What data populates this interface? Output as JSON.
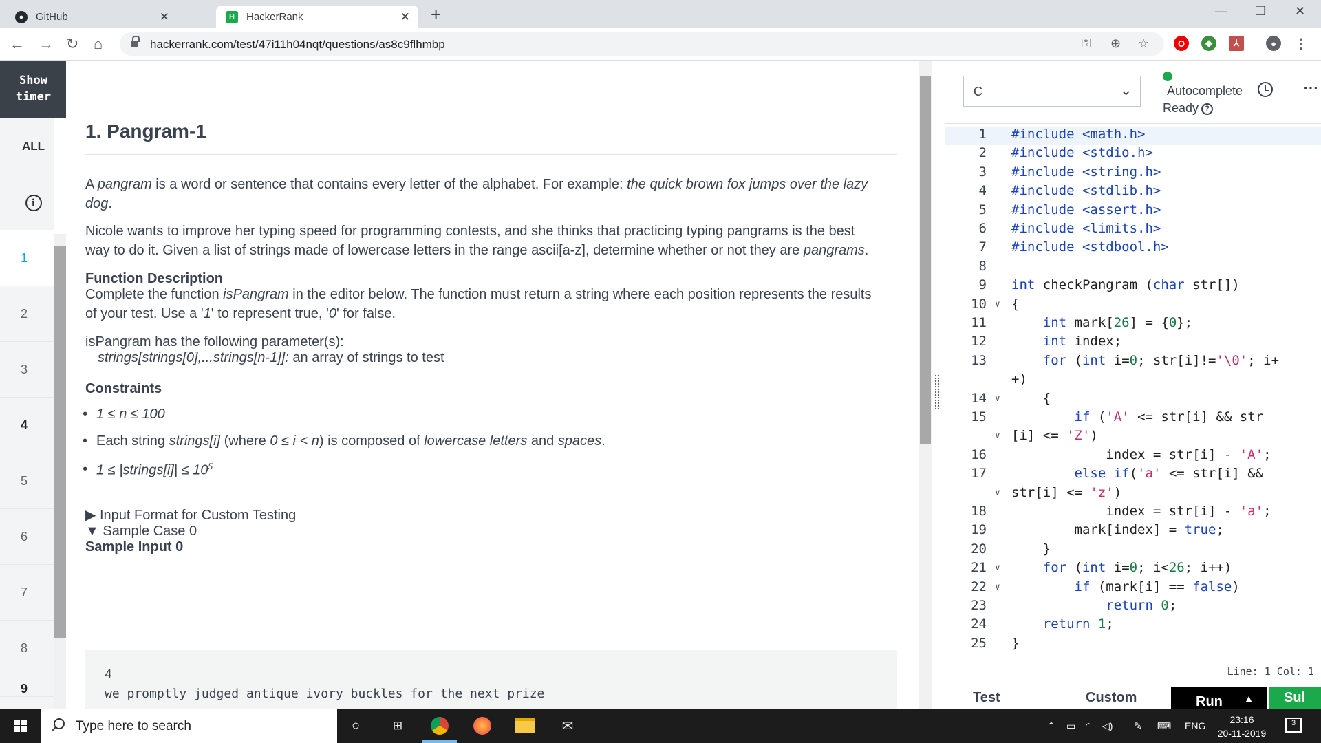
{
  "browser": {
    "tabs": [
      {
        "title": "GitHub",
        "icon": "github-icon"
      },
      {
        "title": "HackerRank",
        "icon": "hackerrank-icon"
      }
    ],
    "url": "hackerrank.com/test/47i11h04nqt/questions/as8c9flhmbp"
  },
  "sidebar": {
    "timer_line1": "Show",
    "timer_line2": "timer",
    "all_label": "ALL",
    "questions": [
      "1",
      "2",
      "3",
      "4",
      "5",
      "6",
      "7",
      "8",
      "9"
    ]
  },
  "problem": {
    "title": "1. Pangram-1",
    "intro_a": "A ",
    "intro_term": "pangram",
    "intro_b": " is a word or sentence that contains every letter of the alphabet.  For example: ",
    "intro_example_1": "the quick brown fox jumps over the lazy",
    "intro_example_2": "dog",
    "intro_end": ".",
    "para2_line1": "Nicole wants to improve her typing speed for programming contests, and she thinks that practicing typing pangrams is the best",
    "para2_line2a": "way to do it.  Given a list of strings made of lowercase letters in the range ascii[a-z], determine whether or not they are ",
    "para2_term": "pangrams",
    "para2_end": ".",
    "fd_heading": "Function Description",
    "fd_line1a": "Complete the function ",
    "fd_func": "isPangram",
    "fd_line1b": " in the editor below. The function must return a string where each position represents the results",
    "fd_line2a": "of your test. Use a '",
    "fd_one": "1",
    "fd_line2b": "' to represent true, '",
    "fd_zero": "0",
    "fd_line2c": "' for false.",
    "params_intro": "isPangram has the following parameter(s):",
    "param_sig": "strings[strings[0],...strings[n-1]]:",
    "param_desc": "  an array of strings to test",
    "constraints_heading": "Constraints",
    "constraint_1": "1 ≤ n ≤ 100",
    "constraint_2a": "Each string ",
    "constraint_2b": "strings[i]",
    "constraint_2c": " (where ",
    "constraint_2d": "0 ≤ i < n",
    "constraint_2e": ") is composed of ",
    "constraint_2f": "lowercase letters",
    "constraint_2g": " and ",
    "constraint_2h": "spaces",
    "constraint_2i": ".",
    "constraint_3": "1 ≤ |strings[i]| ≤ 10",
    "constraint_3_sup": "5",
    "input_format_label": "▶ Input Format for Custom Testing",
    "sample_case_label": "▼ Sample Case 0",
    "sample_input_heading": "Sample Input 0",
    "sample_line_1": "4",
    "sample_line_2": "we promptly judged antique ivory buckles for the next prize"
  },
  "editor": {
    "language": "C",
    "autocomplete_label": "Autocomplete",
    "ready_label": "Ready",
    "cursor_status": "Line: 1 Col: 1",
    "footer_test": "Test",
    "footer_custom": "Custom",
    "run_label": "Run",
    "submit_label": "Sul"
  },
  "code_lines": [
    {
      "n": "1",
      "text": "#include <math.h>"
    },
    {
      "n": "2",
      "text": "#include <stdio.h>"
    },
    {
      "n": "3",
      "text": "#include <string.h>"
    },
    {
      "n": "4",
      "text": "#include <stdlib.h>"
    },
    {
      "n": "5",
      "text": "#include <assert.h>"
    },
    {
      "n": "6",
      "text": "#include <limits.h>"
    },
    {
      "n": "7",
      "text": "#include <stdbool.h>"
    },
    {
      "n": "8",
      "text": ""
    },
    {
      "n": "9",
      "text": "int checkPangram (char str[])"
    },
    {
      "n": "10",
      "text": "{"
    },
    {
      "n": "11",
      "text": "    int mark[26] = {0};"
    },
    {
      "n": "12",
      "text": "    int index;"
    },
    {
      "n": "13",
      "text": "    for (int i=0; str[i]!='\\0'; i+"
    },
    {
      "n": "",
      "text": "+)"
    },
    {
      "n": "14",
      "text": "    {"
    },
    {
      "n": "15",
      "text": "        if ('A' <= str[i] && str"
    },
    {
      "n": "",
      "text": "[i] <= 'Z')"
    },
    {
      "n": "16",
      "text": "            index = str[i] - 'A';"
    },
    {
      "n": "17",
      "text": "        else if('a' <= str[i] &&"
    },
    {
      "n": "",
      "text": "str[i] <= 'z')"
    },
    {
      "n": "18",
      "text": "            index = str[i] - 'a';"
    },
    {
      "n": "19",
      "text": "        mark[index] = true;"
    },
    {
      "n": "20",
      "text": "    }"
    },
    {
      "n": "21",
      "text": "    for (int i=0; i<26; i++)"
    },
    {
      "n": "22",
      "text": "        if (mark[i] == false)"
    },
    {
      "n": "23",
      "text": "            return 0;"
    },
    {
      "n": "24",
      "text": "    return 1;"
    },
    {
      "n": "25",
      "text": "}"
    }
  ],
  "taskbar": {
    "search_placeholder": "Type here to search",
    "lang": "ENG",
    "time": "23:16",
    "date": "20-11-2019",
    "notifications": "3"
  },
  "colors": {
    "accent_green": "#1ba94c",
    "active_question": "#1ba0d8",
    "keyword": "#1a43b8",
    "string": "#c02f6f"
  }
}
